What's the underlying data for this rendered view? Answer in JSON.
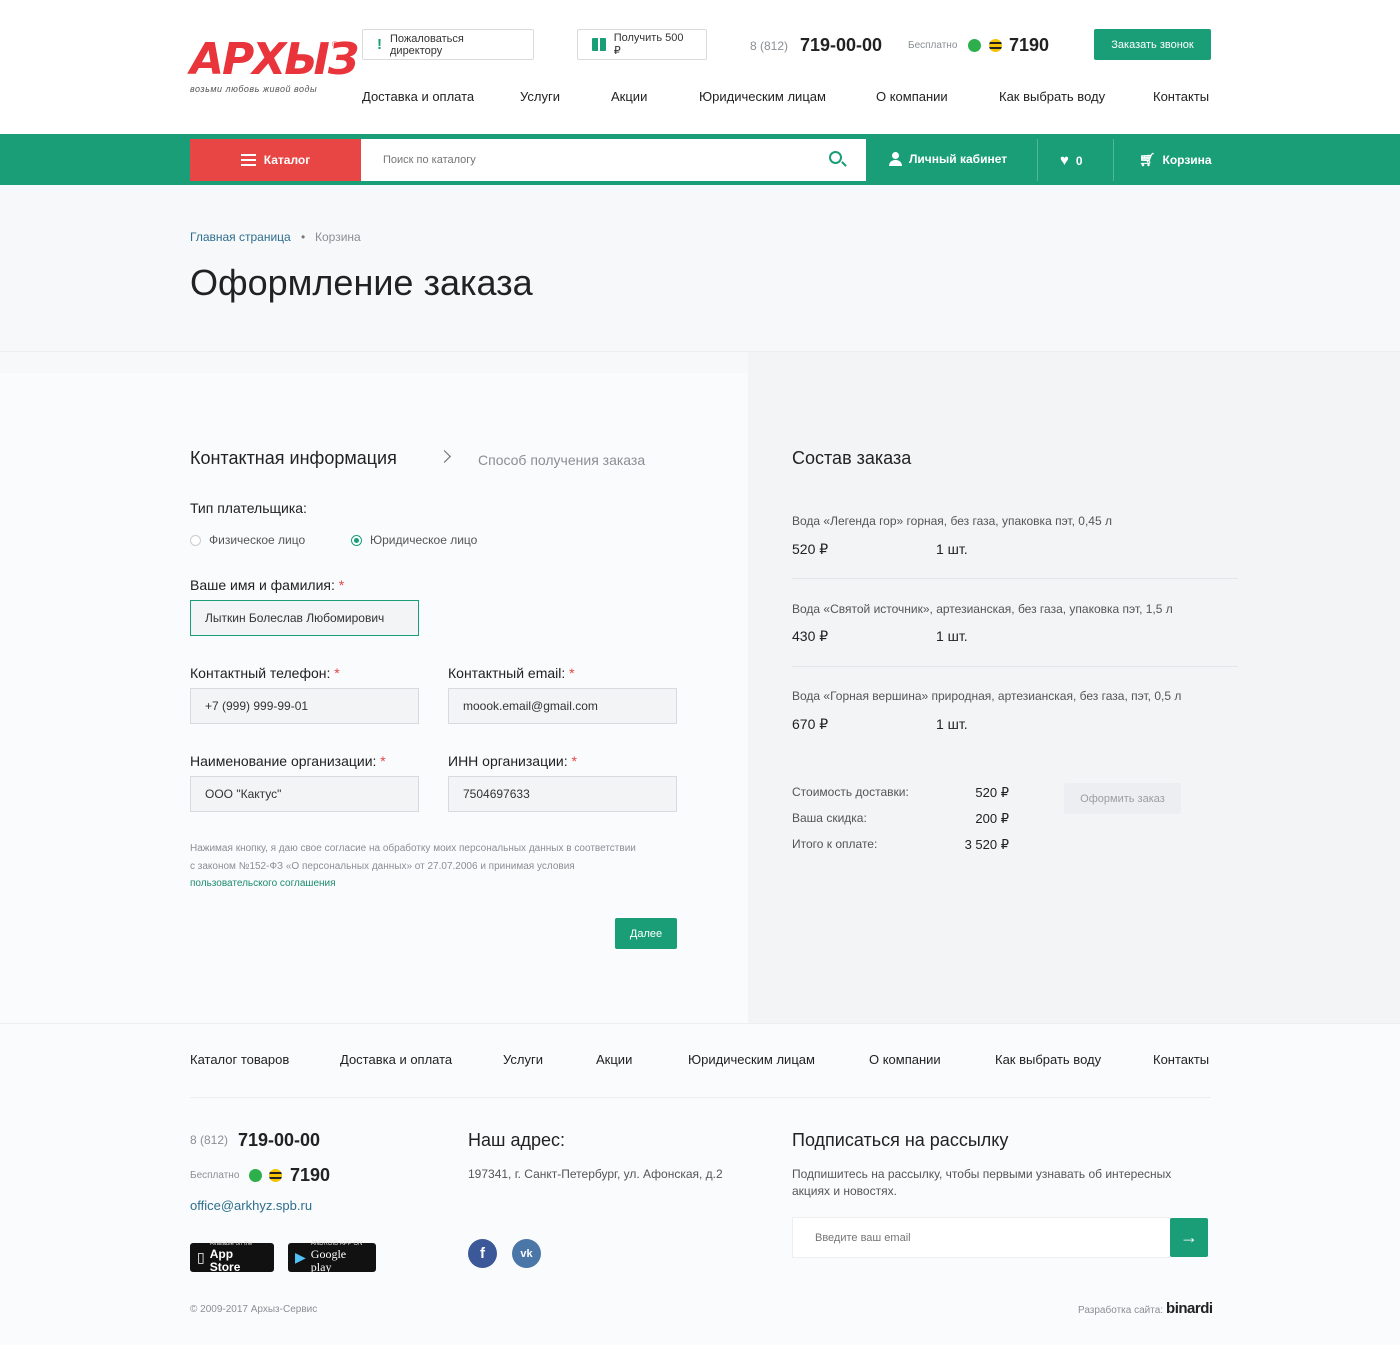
{
  "header": {
    "logo_text": "АРХЫЗ",
    "logo_reg": "®",
    "logo_tagline": "возьми любовь живой воды",
    "complain_label": "Пожаловаться директору",
    "bonus_label": "Получить 500 ₽",
    "phone_prefix": "8 (812)",
    "phone_number": "719-00-00",
    "free_label": "Бесплатно",
    "short_number": "7190",
    "callback_label": "Заказать звонок",
    "nav": [
      "Доставка и оплата",
      "Услуги",
      "Акции",
      "Юридическим лицам",
      "О компании",
      "Как выбрать воду",
      "Контакты"
    ]
  },
  "bar": {
    "catalog_label": "Каталог",
    "search_placeholder": "Поиск по каталогу",
    "account_label": "Личный кабинет",
    "favorites_count": "0",
    "cart_label": "Корзина",
    "colors": {
      "green": "#1a9e77",
      "red": "#e84545"
    }
  },
  "breadcrumb": {
    "home": "Главная страница",
    "sep": "•",
    "current": "Корзина"
  },
  "page_title": "Оформление заказа",
  "checkout": {
    "step_active": "Контактная информация",
    "step_next": "Способ получения заказа",
    "payer_type_label": "Тип плательщика:",
    "payer_options": [
      {
        "label": "Физическое лицо",
        "selected": false
      },
      {
        "label": "Юридическое лицо",
        "selected": true
      }
    ],
    "name_label": "Ваше имя и фамилия:",
    "name_value": "Лыткин Болеслав Любомирович",
    "phone_label": "Контактный телефон:",
    "phone_value": "+7 (999) 999-99-01",
    "email_label": "Контактный email:",
    "email_value": "moook.email@gmail.com",
    "org_label": "Наименование организации:",
    "org_value": "ООО \"Кактус\"",
    "inn_label": "ИНН организации:",
    "inn_value": "7504697633",
    "required_mark": "*",
    "consent_text": "Нажимая кнопку, я даю свое согласие на обработку моих персональных данных в соответствии с законом №152-ФЗ «О персональных данных» от 27.07.2006 и принимая условия",
    "consent_link": "пользовательского соглашения",
    "next_label": "Далее"
  },
  "order": {
    "title": "Состав заказа",
    "items": [
      {
        "name": "Вода «Легенда гор» горная, без газа, упаковка пэт, 0,45 л",
        "price": "520 ₽",
        "qty": "1 шт."
      },
      {
        "name": "Вода «Святой источник», артезианская, без газа, упаковка пэт, 1,5 л",
        "price": "430 ₽",
        "qty": "1 шт."
      },
      {
        "name": "Вода «Горная вершина» природная, артезианская, без газа, пэт, 0,5 л",
        "price": "670 ₽",
        "qty": "1 шт."
      }
    ],
    "delivery_label": "Стоимость доставки:",
    "delivery_value": "520 ₽",
    "discount_label": "Ваша скидка:",
    "discount_value": "200 ₽",
    "total_label": "Итого к оплате:",
    "total_value": "3 520 ₽",
    "submit_label": "Оформить заказ"
  },
  "footer": {
    "nav": [
      "Каталог товаров",
      "Доставка и оплата",
      "Услуги",
      "Акции",
      "Юридическим лицам",
      "О компании",
      "Как выбрать воду",
      "Контакты"
    ],
    "phone_prefix": "8 (812)",
    "phone_number": "719-00-00",
    "free_label": "Бесплатно",
    "short_number": "7190",
    "email": "office@arkhyz.spb.ru",
    "appstore_small": "Available on the",
    "appstore_big": "App Store",
    "googleplay_small": "ANDROID APP ON",
    "googleplay_big": "Google play",
    "address_title": "Наш адрес:",
    "address": "197341, г. Санкт-Петербург, ул. Афонская, д.2",
    "social": [
      "f",
      "vk"
    ],
    "subscribe_title": "Подписаться на рассылку",
    "subscribe_text": "Подпишитесь на рассылку, чтобы первыми узнавать об интересных акциях и новостях.",
    "subscribe_placeholder": "Введите ваш email",
    "copyright": "© 2009-2017 Архыз-Сервис",
    "dev_label": "Разработка сайта:",
    "dev_name": "binardi"
  }
}
